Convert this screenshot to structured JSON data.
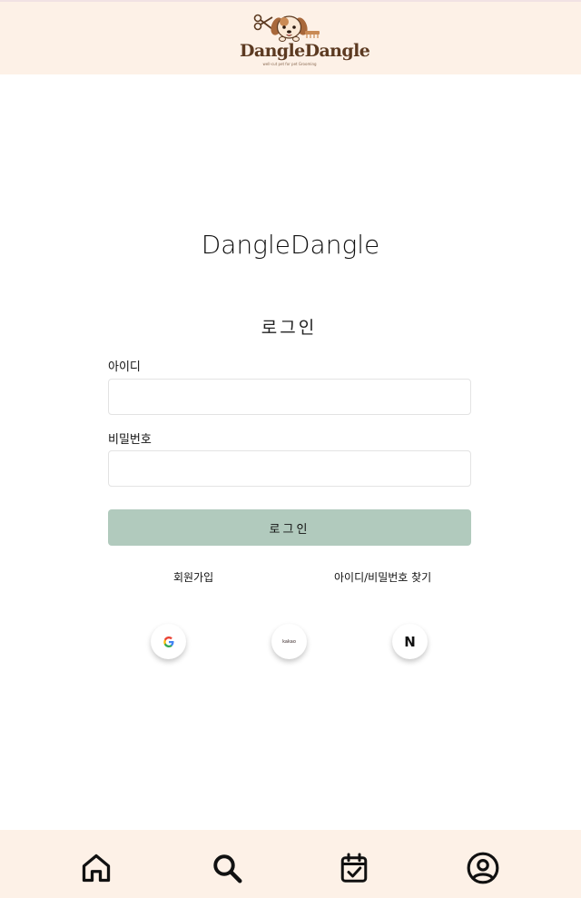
{
  "header": {
    "logo_word": "DangleDangle",
    "logo_tagline": "well-cut pet for pet Grooming"
  },
  "main": {
    "brand_title": "DangleDangle",
    "login_heading": "로그인",
    "id_label": "아이디",
    "id_value": "",
    "password_label": "비밀번호",
    "password_value": "",
    "login_button": "로그인",
    "signup_link": "회원가입",
    "find_link": "아이디/비밀번호 찾기",
    "social": {
      "google_icon": "google-g-icon",
      "kakao_text": "kakao",
      "naver_text": "N"
    }
  },
  "bottom_nav": {
    "items": [
      {
        "icon": "home-icon"
      },
      {
        "icon": "search-icon"
      },
      {
        "icon": "calendar-check-icon"
      },
      {
        "icon": "profile-icon"
      }
    ]
  },
  "colors": {
    "header_bg": "#fdf1e7",
    "login_button_bg": "#b1cabd",
    "logo_brown": "#5c3a21"
  }
}
